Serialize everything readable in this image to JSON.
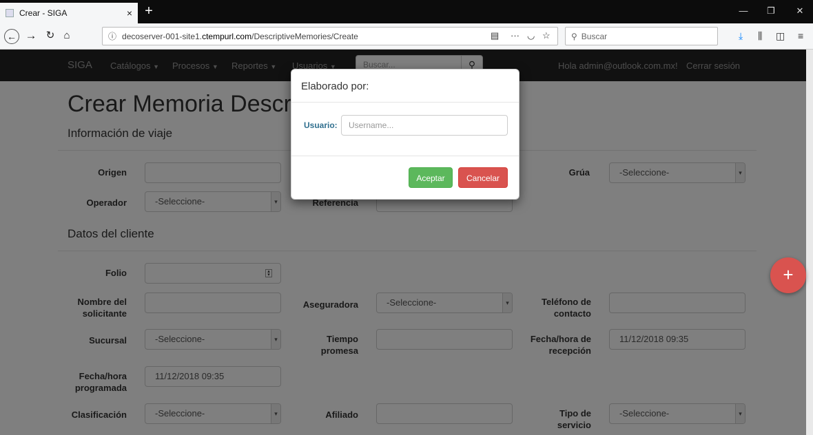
{
  "browser": {
    "tab_title": "Crear - SIGA",
    "tab_close": "×",
    "new_tab": "+",
    "url_domain_pre": "decoserver-001-site1.",
    "url_domain_bold": "ctempurl.com",
    "url_path": "/DescriptiveMemories/Create",
    "search_placeholder": "Buscar",
    "window_minimize": "—",
    "window_restore": "❐",
    "window_close": "✕"
  },
  "app": {
    "brand": "SIGA",
    "menu": [
      "Catálogos",
      "Procesos",
      "Reportes",
      "Usuarios"
    ],
    "search_placeholder": "Buscar...",
    "greeting": "Hola admin@outlook.com.mx!",
    "logout": "Cerrar sesión"
  },
  "page": {
    "title": "Crear Memoria Descriptiva",
    "section_trip": "Información de viaje",
    "section_client": "Datos del cliente"
  },
  "form": {
    "origen_label": "Origen",
    "grua_label": "Grúa",
    "grua_value": "-Seleccione-",
    "operador_label": "Operador",
    "operador_value": "-Seleccione-",
    "referencia_label": "Referencia",
    "folio_label": "Folio",
    "nombre_label": "Nombre del solicitante",
    "aseguradora_label": "Aseguradora",
    "aseguradora_value": "-Seleccione-",
    "telefono_label": "Teléfono de contacto",
    "sucursal_label": "Sucursal",
    "sucursal_value": "-Seleccione-",
    "tiempo_label": "Tiempo promesa",
    "fecha_recepcion_label": "Fecha/hora de recepción",
    "fecha_recepcion_value": "11/12/2018 09:35",
    "fecha_programada_label": "Fecha/hora programada",
    "fecha_programada_value": "11/12/2018 09:35",
    "clasificacion_label": "Clasificación",
    "clasificacion_value": "-Seleccione-",
    "afiliado_label": "Afiliado",
    "tipo_servicio_label": "Tipo de servicio",
    "tipo_servicio_value": "-Seleccione-"
  },
  "modal": {
    "title": "Elaborado por:",
    "user_label": "Usuario:",
    "user_placeholder": "Username...",
    "accept": "Aceptar",
    "cancel": "Cancelar"
  },
  "fab_label": "+",
  "colors": {
    "navbar": "#222222",
    "accept": "#5cb85c",
    "cancel": "#d9534f",
    "fab": "#d9534f"
  }
}
